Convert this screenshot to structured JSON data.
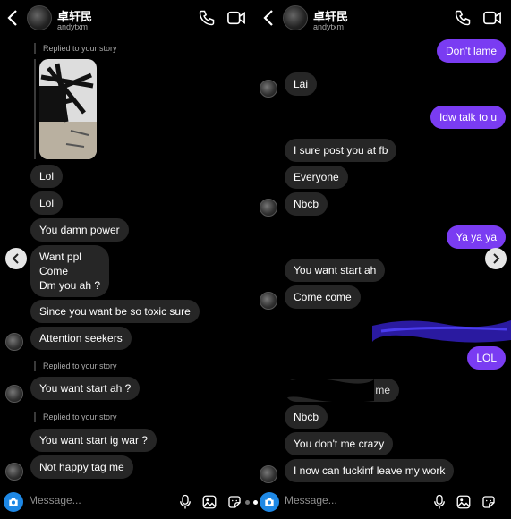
{
  "header": {
    "name": "卓轩民",
    "username": "andytxm"
  },
  "composer": {
    "placeholder": "Message..."
  },
  "left": {
    "replied_top": "Replied to your story",
    "msgs": [
      "Lol",
      "Lol",
      "You damn power",
      "Want ppl",
      "Come",
      "Dm you ah ?",
      "Since you want be so toxic sure",
      "Attention seekers"
    ],
    "replied_1": "Replied to your story",
    "msg_start": "You want start ah ?",
    "replied_2": "Replied to your story",
    "msg_igwar": "You want start ig war ?",
    "msg_tag": "Not happy tag me"
  },
  "right": {
    "out": [
      "Don't lame",
      "Idw talk to u",
      "Ya ya ya",
      "LOL"
    ],
    "in": [
      "Lai",
      "I sure post you at fb",
      "Everyone",
      "Nbcb",
      "You want start ah",
      "Come come",
      "me",
      "Nbcb",
      "You don't me crazy",
      "I now can fuckinf leave my work"
    ]
  },
  "colors": {
    "outgoing_bubble": "#7a3cf2",
    "incoming_bubble": "#262626",
    "camera_button": "#1e88e5"
  }
}
